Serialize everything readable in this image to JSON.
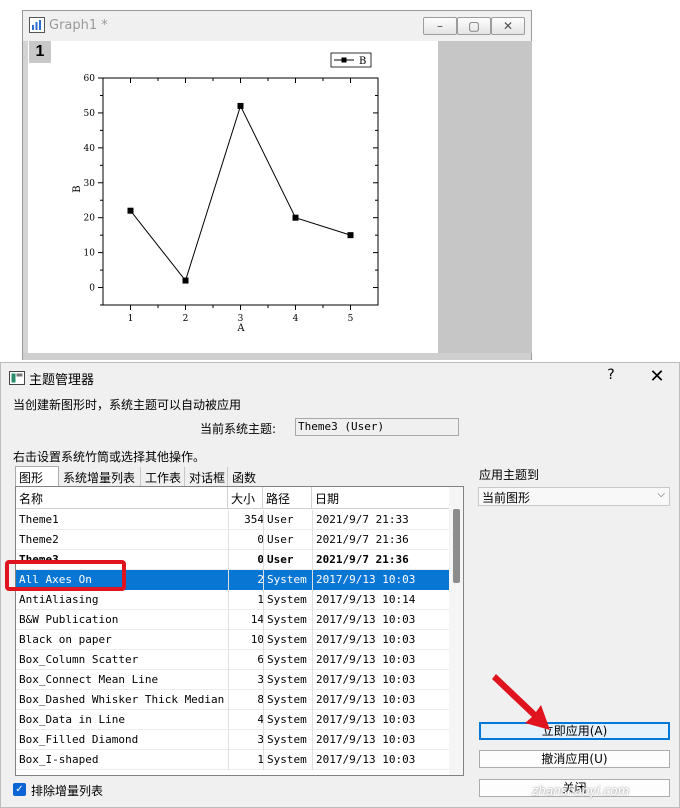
{
  "graph_window": {
    "title": "Graph1 *",
    "layer_number": "1",
    "controls": {
      "minimize": "–",
      "restore": "▢",
      "close": "✕"
    }
  },
  "chart_data": {
    "type": "line",
    "series": [
      {
        "name": "B",
        "x": [
          1,
          2,
          3,
          4,
          5
        ],
        "y": [
          22,
          2,
          52,
          20,
          15
        ],
        "marker": "square",
        "color": "#000000"
      }
    ],
    "xlabel": "A",
    "ylabel": "B",
    "xlim": [
      0.5,
      5.5
    ],
    "ylim": [
      -5,
      60
    ],
    "xticks": [
      1,
      2,
      3,
      4,
      5
    ],
    "yticks": [
      0,
      10,
      20,
      30,
      40,
      50,
      60
    ],
    "grid": false,
    "legend": "top-right",
    "legend_label": "B"
  },
  "dialog": {
    "title": "主题管理器",
    "help": "?",
    "close": "✕",
    "info_text": "当创建新图形时，系统主题可以自动被应用",
    "current_theme_label": "当前系统主题:",
    "current_theme_value": "Theme3 (User)",
    "instruction": "右击设置系统竹筒或选择其他操作。",
    "tabs": [
      "图形",
      "系统增量列表",
      "工作表",
      "对话框",
      "函数"
    ],
    "columns": [
      "名称",
      "大小",
      "路径",
      "日期"
    ],
    "rows": [
      {
        "name": "Theme1",
        "size": "354",
        "path": "User",
        "date": "2021/9/7 21:33"
      },
      {
        "name": "Theme2",
        "size": "0",
        "path": "User",
        "date": "2021/9/7 21:36"
      },
      {
        "name": "Theme3",
        "size": "0",
        "path": "User",
        "date": "2021/9/7 21:36",
        "bold": true
      },
      {
        "name": "All Axes On",
        "size": "2",
        "path": "System",
        "date": "2017/9/13 10:03",
        "selected": true
      },
      {
        "name": "AntiAliasing",
        "size": "1",
        "path": "System",
        "date": "2017/9/13 10:14"
      },
      {
        "name": "B&W Publication",
        "size": "14",
        "path": "System",
        "date": "2017/9/13 10:03"
      },
      {
        "name": "Black on paper",
        "size": "10",
        "path": "System",
        "date": "2017/9/13 10:03"
      },
      {
        "name": "Box_Column Scatter",
        "size": "6",
        "path": "System",
        "date": "2017/9/13 10:03"
      },
      {
        "name": "Box_Connect Mean Line",
        "size": "3",
        "path": "System",
        "date": "2017/9/13 10:03"
      },
      {
        "name": "Box_Dashed Whisker Thick Median",
        "size": "8",
        "path": "System",
        "date": "2017/9/13 10:03"
      },
      {
        "name": "Box_Data in Line",
        "size": "4",
        "path": "System",
        "date": "2017/9/13 10:03"
      },
      {
        "name": "Box_Filled Diamond",
        "size": "3",
        "path": "System",
        "date": "2017/9/13 10:03"
      },
      {
        "name": "Box_I-shaped",
        "size": "1",
        "path": "System",
        "date": "2017/9/13 10:03"
      }
    ],
    "apply_to_label": "应用主题到",
    "apply_to_value": "当前图形",
    "apply_now": "立即应用(A)",
    "undo_apply": "撤消应用(U)",
    "close_button": "关闭",
    "exclude_label": "排除增量列表",
    "exclude_checked": true
  },
  "annotations": {
    "highlight_color": "#e0141e",
    "arrow_color": "#e0141e",
    "watermark": "zhanshaoyi.com"
  },
  "colors": {
    "selection": "#0a76d4",
    "checkbox": "#0a64d4"
  }
}
